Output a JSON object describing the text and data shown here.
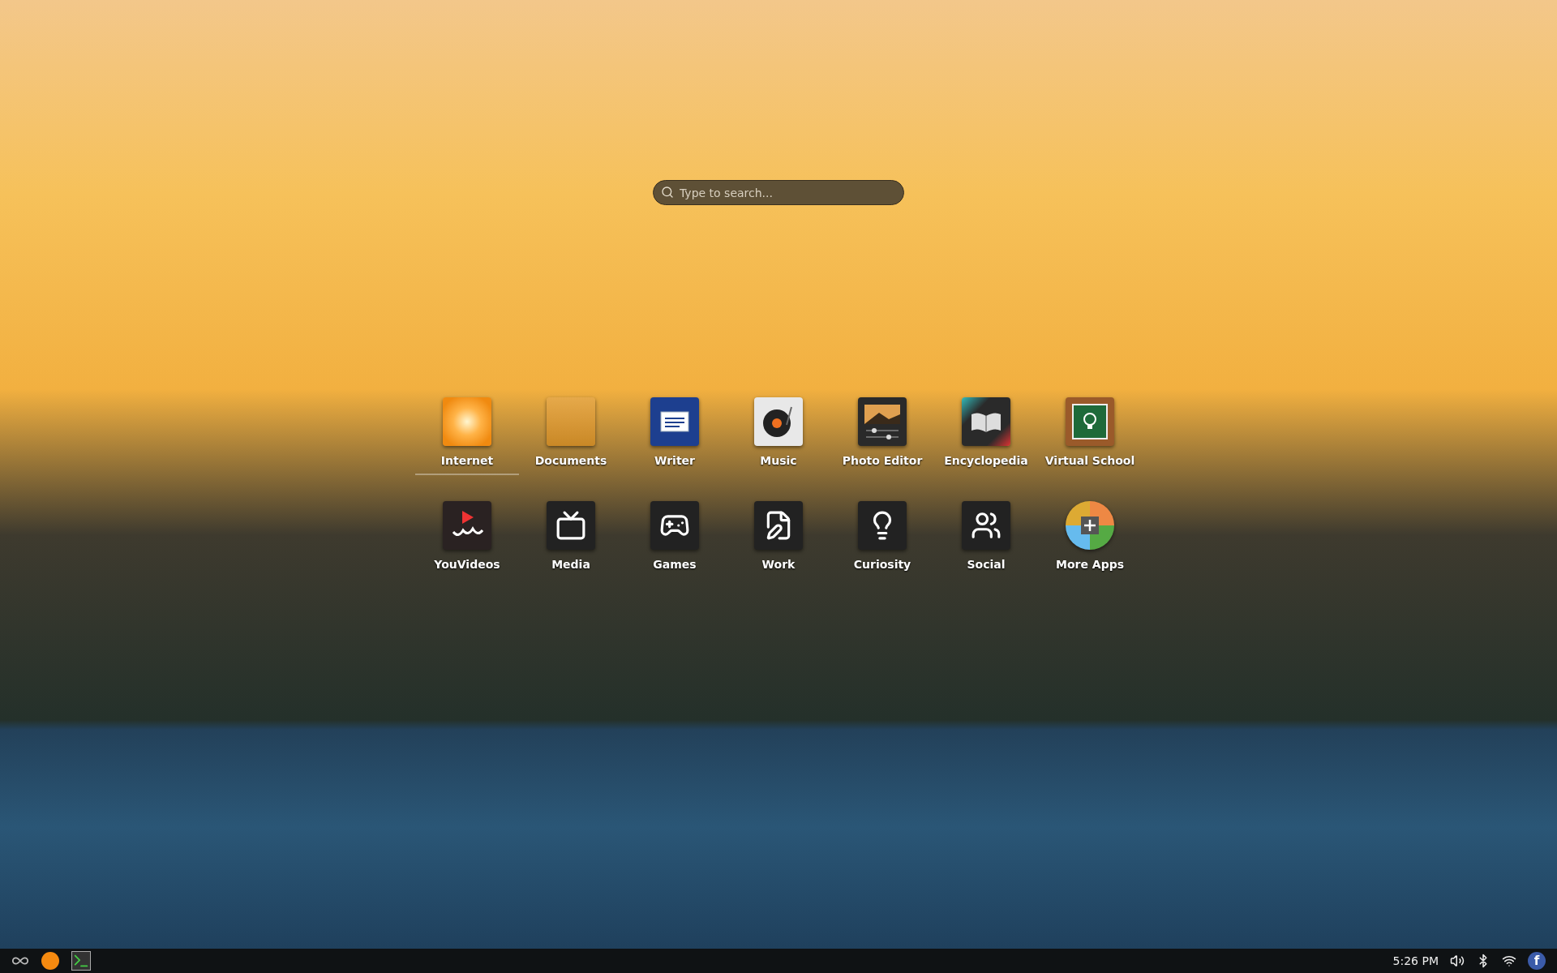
{
  "search": {
    "placeholder": "Type to search..."
  },
  "apps": [
    {
      "label": "Internet",
      "kind": "internet",
      "selected": true
    },
    {
      "label": "Documents",
      "kind": "documents",
      "selected": false
    },
    {
      "label": "Writer",
      "kind": "writer",
      "selected": false
    },
    {
      "label": "Music",
      "kind": "music",
      "selected": false
    },
    {
      "label": "Photo Editor",
      "kind": "photo",
      "selected": false
    },
    {
      "label": "Encyclopedia",
      "kind": "encyclopedia",
      "selected": false
    },
    {
      "label": "Virtual School",
      "kind": "school",
      "selected": false
    },
    {
      "label": "YouVideos",
      "kind": "videos",
      "selected": false
    },
    {
      "label": "Media",
      "kind": "media",
      "selected": false
    },
    {
      "label": "Games",
      "kind": "games",
      "selected": false
    },
    {
      "label": "Work",
      "kind": "work",
      "selected": false
    },
    {
      "label": "Curiosity",
      "kind": "curiosity",
      "selected": false
    },
    {
      "label": "Social",
      "kind": "social",
      "selected": false
    },
    {
      "label": "More Apps",
      "kind": "more",
      "selected": false
    }
  ],
  "taskbar": {
    "clock": "5:26 PM",
    "badge": "f"
  }
}
